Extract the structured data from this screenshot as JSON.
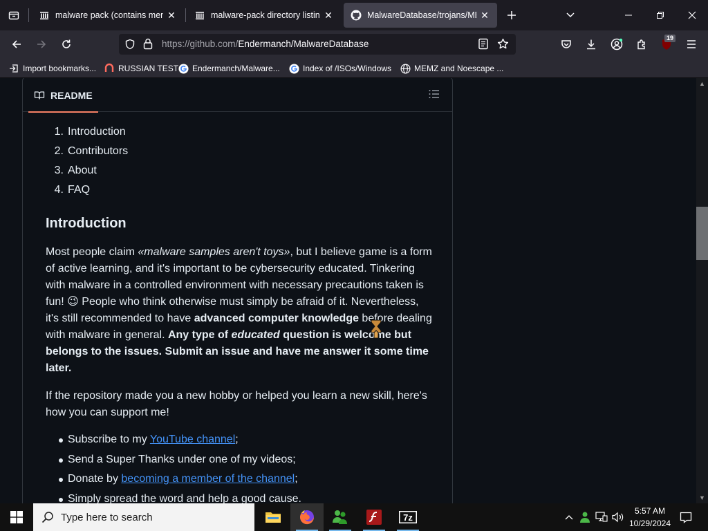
{
  "browser": {
    "tabs": [
      {
        "title": "malware pack (contains memz)",
        "active": false
      },
      {
        "title": "malware-pack directory listing",
        "active": false
      },
      {
        "title": "MalwareDatabase/trojans/MEM",
        "active": true
      }
    ],
    "url_host": "https://github.com/",
    "url_path": "Endermanch/MalwareDatabase",
    "extension_badge": "19",
    "bookmarks": [
      "Import bookmarks...",
      "RUSSIAN TEST",
      "Endermanch/Malware...",
      "Index of /ISOs/Windows",
      "MEMZ and Noescape ..."
    ]
  },
  "readme": {
    "tab_label": "README",
    "toc": [
      {
        "num": "1.",
        "label": "Introduction"
      },
      {
        "num": "2.",
        "label": "Contributors"
      },
      {
        "num": "3.",
        "label": "About"
      },
      {
        "num": "4.",
        "label": "FAQ"
      }
    ],
    "heading": "Introduction",
    "p1": {
      "a": "Most people claim ",
      "a_em": "«malware samples aren't toys»",
      "b": ", but I believe game is a form of active learning, and it's important to be cybersecurity educated. Tinkering with malware in a controlled environment with necessary precautions taken is fun! ",
      "emoji": "😉",
      "c": " People who think otherwise must simply be afraid of it. Nevertheless, it's still recommended to have ",
      "c_strong": "advanced computer knowledge",
      "d": " before dealing with malware in general. ",
      "e_strong1": "Any type of ",
      "e_strong_em": "educated",
      "e_strong2": " question is welcome but belongs to the issues. Submit an issue and have me answer it some time later."
    },
    "p2": "If the repository made you a new hobby or helped you learn a new skill, here's how you can support me!",
    "support": [
      {
        "pre": "Subscribe to my ",
        "link": "YouTube channel",
        "post": ";"
      },
      {
        "pre": "Send a Super Thanks under one of my videos;",
        "link": "",
        "post": ""
      },
      {
        "pre": "Donate by ",
        "link": "becoming a member of the channel",
        "post": ";"
      },
      {
        "pre": "Simply spread the word and help a good cause.",
        "link": "",
        "post": ""
      }
    ]
  },
  "taskbar": {
    "search_placeholder": "Type here to search",
    "time": "5:57 AM",
    "date": "10/29/2024",
    "apps": [
      "file-explorer",
      "firefox",
      "msn-messenger",
      "flash-player",
      "7-zip"
    ]
  }
}
